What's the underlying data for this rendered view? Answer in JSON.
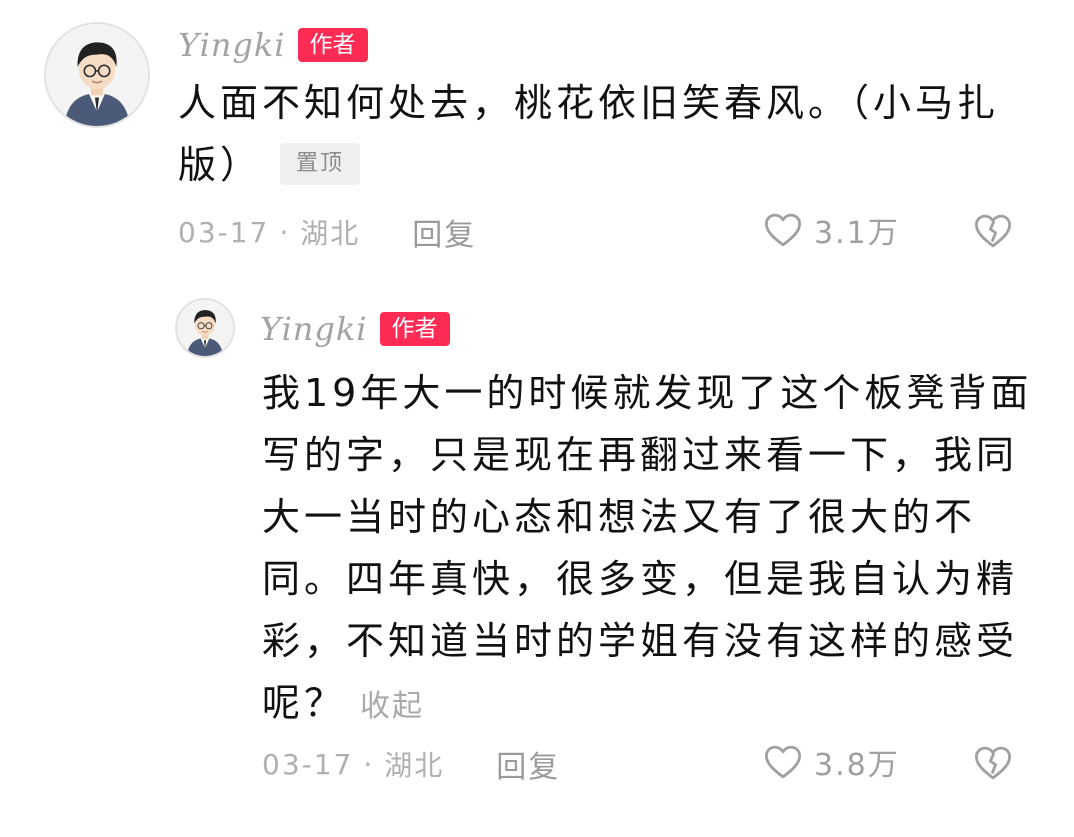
{
  "comments": [
    {
      "username": "Yingki",
      "author_badge": "作者",
      "avatar": "avatar-cartoon-boy-glasses",
      "content": "人面不知何处去，桃花依旧笑春风。（小马扎版）",
      "pin_tag": "置顶",
      "date": "03-17",
      "separator": "·",
      "location": "湖北",
      "reply_label": "回复",
      "like_icon": "heart-outline-icon",
      "like_count": "3.1万",
      "dislike_icon": "broken-heart-icon"
    },
    {
      "username": "Yingki",
      "author_badge": "作者",
      "avatar": "avatar-cartoon-boy-glasses",
      "content": "我19年大一的时候就发现了这个板凳背面写的字，只是现在再翻过来看一下，我同大一当时的心态和想法又有了很大的不同。四年真快，很多变，但是我自认为精彩，不知道当时的学姐有没有这样的感受呢？",
      "collapse_label": "收起",
      "date": "03-17",
      "separator": "·",
      "location": "湖北",
      "reply_label": "回复",
      "like_icon": "heart-outline-icon",
      "like_count": "3.8万",
      "dislike_icon": "broken-heart-icon"
    }
  ],
  "colors": {
    "author_badge_bg": "#fe2c55",
    "meta_text": "#b0b0b0",
    "pin_tag_bg": "#efefef"
  }
}
